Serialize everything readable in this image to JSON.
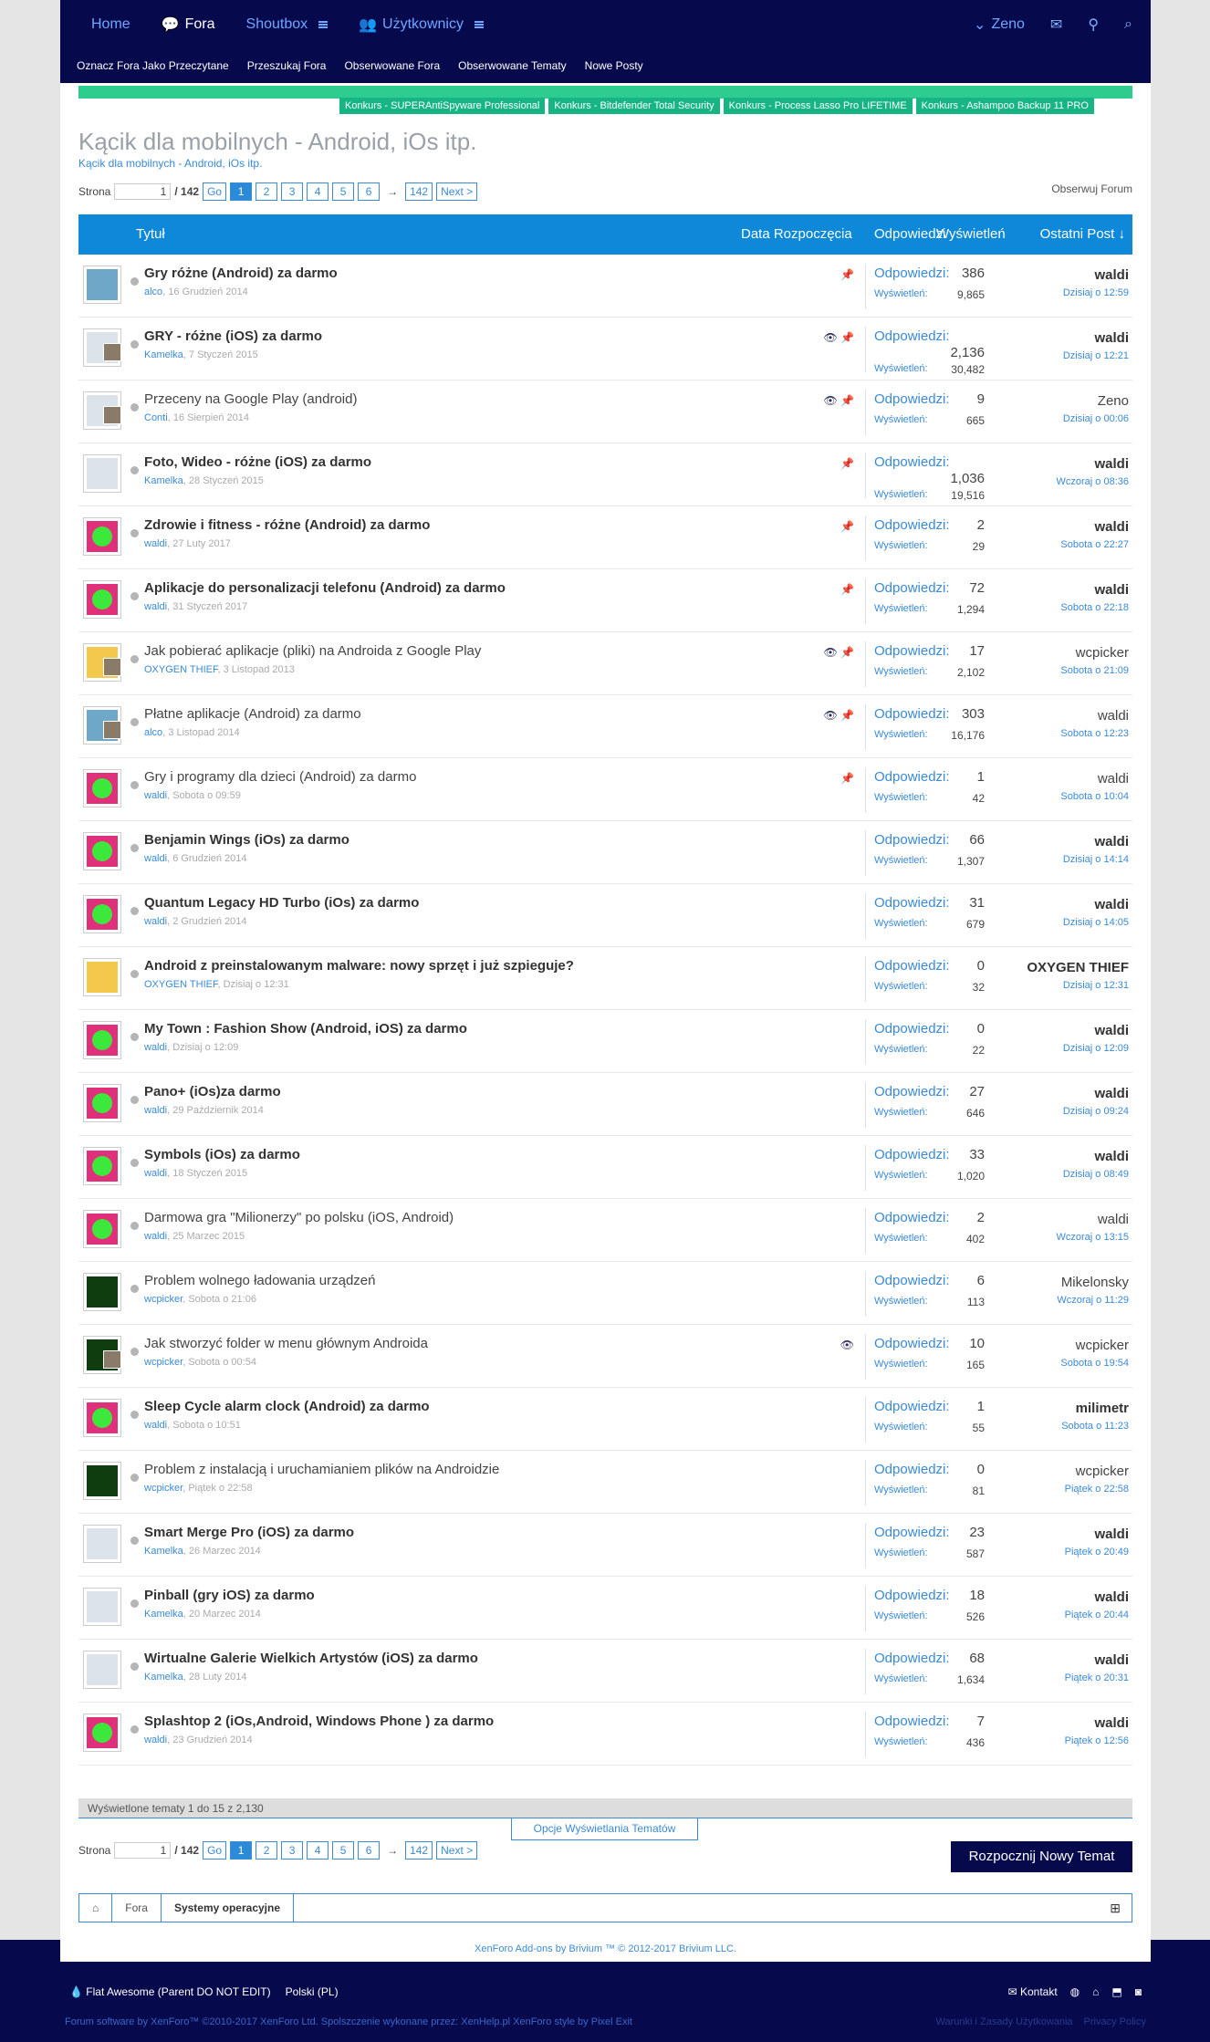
{
  "nav": {
    "home": "Home",
    "forums": "Fora",
    "shoutbox": "Shoutbox",
    "users": "Użytkownicy",
    "user": "Zeno"
  },
  "subnav": [
    "Oznacz Fora Jako Przeczytane",
    "Przeszukaj Fora",
    "Obserwowane Fora",
    "Obserwowane Tematy",
    "Nowe Posty"
  ],
  "promos": [
    "Konkurs - SUPERAntiSpyware Professional",
    "Konkurs - Bitdefender Total Security",
    "Konkurs - Process Lasso Pro LIFETIME",
    "Konkurs - Ashampoo Backup 11 PRO"
  ],
  "forum": {
    "title": "Kącik dla mobilnych - Android, iOs itp.",
    "breadcrumb": "Kącik dla mobilnych - Android, iOs itp.",
    "watch": "Obserwuj Forum"
  },
  "pager": {
    "label": "Strona",
    "current": "1",
    "total": "/ 142",
    "go": "Go",
    "pages": [
      "1",
      "2",
      "3",
      "4",
      "5",
      "6"
    ],
    "arrow": "→",
    "last": "142",
    "next": "Next >"
  },
  "table_header": {
    "title": "Tytuł",
    "start_date": "Data Rozpoczęcia",
    "replies": "Odpowiedzi",
    "views": "Wyświetleń",
    "last_post": "Ostatni Post ↓"
  },
  "labels": {
    "replies": "Odpowiedzi:",
    "views": "Wyświetleń:"
  },
  "threads": [
    {
      "title": "Gry różne (Android) za darmo",
      "bold": true,
      "author": "alco",
      "date": "16 Grudzień 2014",
      "icons": "📌",
      "replies": "386",
      "views": "9,865",
      "last_user": "waldi",
      "last_bold": true,
      "last_date": "Dzisiaj o 12:59",
      "avatar": "av-pixel",
      "small": false,
      "tall": false
    },
    {
      "title": "GRY - różne (iOS) za darmo",
      "bold": true,
      "author": "Kamelka",
      "date": "7 Styczeń 2015",
      "icons": "👁 📌",
      "replies": "2,136",
      "views": "30,482",
      "last_user": "waldi",
      "last_bold": true,
      "last_date": "Dzisiaj o 12:21",
      "avatar": "av-man",
      "small": true,
      "tall": true
    },
    {
      "title": "Przeceny na Google Play (android)",
      "bold": false,
      "author": "Conti",
      "date": "16 Sierpień 2014",
      "icons": "👁 📌",
      "replies": "9",
      "views": "665",
      "last_user": "Zeno",
      "last_bold": false,
      "last_date": "Dzisiaj o 00:06",
      "avatar": "av-man",
      "small": true,
      "tall": false
    },
    {
      "title": "Foto, Wideo - różne (iOS) za darmo",
      "bold": true,
      "author": "Kamelka",
      "date": "28 Styczeń 2015",
      "icons": "📌",
      "replies": "1,036",
      "views": "19,516",
      "last_user": "waldi",
      "last_bold": true,
      "last_date": "Wczoraj o 08:36",
      "avatar": "av-man",
      "small": false,
      "tall": true
    },
    {
      "title": "Zdrowie i fitness - różne (Android) za darmo",
      "bold": true,
      "author": "waldi",
      "date": "27 Luty 2017",
      "icons": "📌",
      "replies": "2",
      "views": "29",
      "last_user": "waldi",
      "last_bold": true,
      "last_date": "Sobota o 22:27",
      "avatar": "av-heart",
      "small": false,
      "tall": false
    },
    {
      "title": "Aplikacje do personalizacji telefonu (Android) za darmo",
      "bold": true,
      "author": "waldi",
      "date": "31 Styczeń 2017",
      "icons": "📌",
      "replies": "72",
      "views": "1,294",
      "last_user": "waldi",
      "last_bold": true,
      "last_date": "Sobota o 22:18",
      "avatar": "av-heart",
      "small": false,
      "tall": false
    },
    {
      "title": "Jak pobierać aplikacje (pliki) na Androida z Google Play",
      "bold": false,
      "author": "OXYGEN THIEF",
      "date": "3 Listopad 2013",
      "icons": "👁 📌",
      "replies": "17",
      "views": "2,102",
      "last_user": "wcpicker",
      "last_bold": false,
      "last_date": "Sobota o 21:09",
      "avatar": "av-yellow",
      "small": true,
      "tall": false
    },
    {
      "title": "Płatne aplikacje (Android) za darmo",
      "bold": false,
      "author": "alco",
      "date": "3 Listopad 2014",
      "icons": "👁 📌",
      "replies": "303",
      "views": "16,176",
      "last_user": "waldi",
      "last_bold": false,
      "last_date": "Sobota o 12:23",
      "avatar": "av-pixel",
      "small": true,
      "tall": false
    },
    {
      "title": "Gry i programy dla dzieci (Android) za darmo",
      "bold": false,
      "author": "waldi",
      "date": "Sobota o 09:59",
      "icons": "📌",
      "replies": "1",
      "views": "42",
      "last_user": "waldi",
      "last_bold": false,
      "last_date": "Sobota o 10:04",
      "avatar": "av-heart",
      "small": false,
      "tall": false
    },
    {
      "title": "Benjamin Wings (iOs) za darmo",
      "bold": true,
      "author": "waldi",
      "date": "6 Grudzień 2014",
      "icons": "",
      "replies": "66",
      "views": "1,307",
      "last_user": "waldi",
      "last_bold": true,
      "last_date": "Dzisiaj o 14:14",
      "avatar": "av-heart",
      "small": false,
      "tall": false
    },
    {
      "title": "Quantum Legacy HD Turbo (iOs) za darmo",
      "bold": true,
      "author": "waldi",
      "date": "2 Grudzień 2014",
      "icons": "",
      "replies": "31",
      "views": "679",
      "last_user": "waldi",
      "last_bold": true,
      "last_date": "Dzisiaj o 14:05",
      "avatar": "av-heart",
      "small": false,
      "tall": false
    },
    {
      "title": "Android z preinstalowanym malware: nowy sprzęt i już szpieguje?",
      "bold": true,
      "author": "OXYGEN THIEF",
      "date": "Dzisiaj o 12:31",
      "icons": "",
      "replies": "0",
      "views": "32",
      "last_user": "OXYGEN THIEF",
      "last_bold": true,
      "last_date": "Dzisiaj o 12:31",
      "avatar": "av-yellow",
      "small": false,
      "tall": false
    },
    {
      "title": "My Town : Fashion Show (Android, iOS) za darmo",
      "bold": true,
      "author": "waldi",
      "date": "Dzisiaj o 12:09",
      "icons": "",
      "replies": "0",
      "views": "22",
      "last_user": "waldi",
      "last_bold": true,
      "last_date": "Dzisiaj o 12:09",
      "avatar": "av-heart",
      "small": false,
      "tall": false
    },
    {
      "title": "Pano+ (iOs)za darmo",
      "bold": true,
      "author": "waldi",
      "date": "29 Październik 2014",
      "icons": "",
      "replies": "27",
      "views": "646",
      "last_user": "waldi",
      "last_bold": true,
      "last_date": "Dzisiaj o 09:24",
      "avatar": "av-heart",
      "small": false,
      "tall": false
    },
    {
      "title": "Symbols (iOs) za darmo",
      "bold": true,
      "author": "waldi",
      "date": "18 Styczeń 2015",
      "icons": "",
      "replies": "33",
      "views": "1,020",
      "last_user": "waldi",
      "last_bold": true,
      "last_date": "Dzisiaj o 08:49",
      "avatar": "av-heart",
      "small": false,
      "tall": false
    },
    {
      "title": "Darmowa gra \"Milionerzy\" po polsku (iOS, Android)",
      "bold": false,
      "author": "waldi",
      "date": "25 Marzec 2015",
      "icons": "",
      "replies": "2",
      "views": "402",
      "last_user": "waldi",
      "last_bold": false,
      "last_date": "Wczoraj o 13:15",
      "avatar": "av-heart",
      "small": false,
      "tall": false
    },
    {
      "title": "Problem wolnego ładowania urządzeń",
      "bold": false,
      "author": "wcpicker",
      "date": "Sobota o 21:06",
      "icons": "",
      "replies": "6",
      "views": "113",
      "last_user": "Mikelonsky",
      "last_bold": false,
      "last_date": "Wczoraj o 11:29",
      "avatar": "av-green",
      "small": false,
      "tall": false
    },
    {
      "title": "Jak stworzyć folder w menu głównym Androida",
      "bold": false,
      "author": "wcpicker",
      "date": "Sobota o 00:54",
      "icons": "👁",
      "replies": "10",
      "views": "165",
      "last_user": "wcpicker",
      "last_bold": false,
      "last_date": "Sobota o 19:54",
      "avatar": "av-green",
      "small": true,
      "tall": false
    },
    {
      "title": "Sleep Cycle alarm clock (Android) za darmo",
      "bold": true,
      "author": "waldi",
      "date": "Sobota o 10:51",
      "icons": "",
      "replies": "1",
      "views": "55",
      "last_user": "milimetr",
      "last_bold": true,
      "last_date": "Sobota o 11:23",
      "avatar": "av-heart",
      "small": false,
      "tall": false
    },
    {
      "title": "Problem z instalacją i uruchamianiem plików na Androidzie",
      "bold": false,
      "author": "wcpicker",
      "date": "Piątek o 22:58",
      "icons": "",
      "replies": "0",
      "views": "81",
      "last_user": "wcpicker",
      "last_bold": false,
      "last_date": "Piątek o 22:58",
      "avatar": "av-green",
      "small": false,
      "tall": false
    },
    {
      "title": "Smart Merge Pro (iOS) za darmo",
      "bold": true,
      "author": "Kamelka",
      "date": "26 Marzec 2014",
      "icons": "",
      "replies": "23",
      "views": "587",
      "last_user": "waldi",
      "last_bold": true,
      "last_date": "Piątek o 20:49",
      "avatar": "av-man",
      "small": false,
      "tall": false
    },
    {
      "title": "Pinball (gry iOS) za darmo",
      "bold": true,
      "author": "Kamelka",
      "date": "20 Marzec 2014",
      "icons": "",
      "replies": "18",
      "views": "526",
      "last_user": "waldi",
      "last_bold": true,
      "last_date": "Piątek o 20:44",
      "avatar": "av-man",
      "small": false,
      "tall": false
    },
    {
      "title": "Wirtualne Galerie Wielkich Artystów (iOS) za darmo",
      "bold": true,
      "author": "Kamelka",
      "date": "28 Luty 2014",
      "icons": "",
      "replies": "68",
      "views": "1,634",
      "last_user": "waldi",
      "last_bold": true,
      "last_date": "Piątek o 20:31",
      "avatar": "av-man",
      "small": false,
      "tall": false
    },
    {
      "title": "Splashtop 2 (iOs,Android, Windows Phone ) za darmo",
      "bold": true,
      "author": "waldi",
      "date": "23 Grudzień 2014",
      "icons": "",
      "replies": "7",
      "views": "436",
      "last_user": "waldi",
      "last_bold": true,
      "last_date": "Piątek o 12:56",
      "avatar": "av-heart",
      "small": false,
      "tall": false
    }
  ],
  "footer_list": {
    "shown": "Wyświetlone tematy 1 do 15 z 2,130",
    "options": "Opcje Wyświetlania Tematów",
    "new_thread": "Rozpocznij Nowy Temat"
  },
  "crumbs": [
    "Fora",
    "Systemy operacyjne"
  ],
  "credit": "XenForo Add-ons by Brivium ™ © 2012-2017 Brivium LLC.",
  "bottom": {
    "style": "Flat Awesome (Parent DO NOT EDIT)",
    "lang": "Polski (PL)",
    "contact": "Kontakt",
    "software": "Forum software by XenForo™ ©2010-2017 XenForo Ltd. Spolszczenie wykonane przez: XenHelp.pl XenForo style by Pixel Exit",
    "terms": "Warunki i Zasady Użytkowania",
    "privacy": "Privacy Policy"
  }
}
